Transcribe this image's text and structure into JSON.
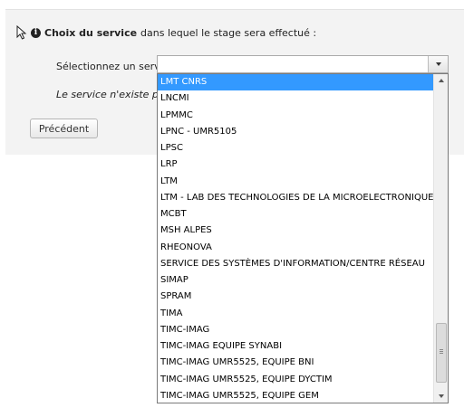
{
  "form": {
    "heading_bold": "Choix du service",
    "heading_rest": "dans lequel le stage sera effectué :",
    "select_label": "Sélectionnez un service :",
    "note": "Le service n'existe pas encore dans la liste",
    "prev_button": "Précédent"
  },
  "dropdown": {
    "selected_index": 0,
    "options": [
      "LMT CNRS",
      "LNCMI",
      "LPMMC",
      "LPNC - UMR5105",
      "LPSC",
      "LRP",
      "LTM",
      "LTM - LAB DES TECHNOLOGIES DE LA MICROELECTRONIQUE",
      "MCBT",
      "MSH ALPES",
      "RHEONOVA",
      "SERVICE DES SYSTÈMES D'INFORMATION/CENTRE RÉSEAU",
      "SIMAP",
      "SPRAM",
      "TIMA",
      "TIMC-IMAG",
      "TIMC-IMAG EQUIPE SYNABI",
      "TIMC-IMAG UMR5525, EQUIPE BNI",
      "TIMC-IMAG UMR5525, EQUIPE DYCTIM",
      "TIMC-IMAG UMR5525, EQUIPE GEM"
    ]
  },
  "colors": {
    "selected": "#3399ff",
    "panel": "#f3f3f3"
  },
  "icons": {
    "heading": "info-icon",
    "pointer": "cursor-icon"
  }
}
